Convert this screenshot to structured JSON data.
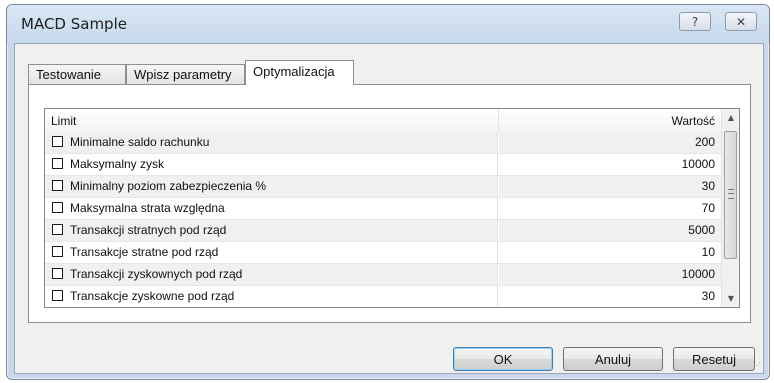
{
  "window": {
    "title": "MACD Sample",
    "help_glyph": "?",
    "close_glyph": "✕"
  },
  "tabs": [
    {
      "label": "Testowanie"
    },
    {
      "label": "Wpisz parametry"
    },
    {
      "label": "Optymalizacja"
    }
  ],
  "active_tab_index": 2,
  "grid": {
    "headers": {
      "limit": "Limit",
      "value": "Wartość"
    },
    "rows": [
      {
        "label": "Minimalne saldo rachunku",
        "value": "200",
        "checked": false
      },
      {
        "label": "Maksymalny zysk",
        "value": "10000",
        "checked": false
      },
      {
        "label": "Minimalny poziom zabezpieczenia %",
        "value": "30",
        "checked": false
      },
      {
        "label": "Maksymalna strata względna",
        "value": "70",
        "checked": false
      },
      {
        "label": "Transakcji stratnych pod rząd",
        "value": "5000",
        "checked": false
      },
      {
        "label": "Transakcje stratne pod rząd",
        "value": "10",
        "checked": false
      },
      {
        "label": "Transakcji zyskownych pod rząd",
        "value": "10000",
        "checked": false
      },
      {
        "label": "Transakcje zyskowne pod rząd",
        "value": "30",
        "checked": false
      }
    ],
    "scroll_up_glyph": "▲",
    "scroll_down_glyph": "▼"
  },
  "buttons": {
    "ok": "OK",
    "cancel": "Anuluj",
    "reset": "Resetuj"
  },
  "resize_grip_glyph": "⋰"
}
